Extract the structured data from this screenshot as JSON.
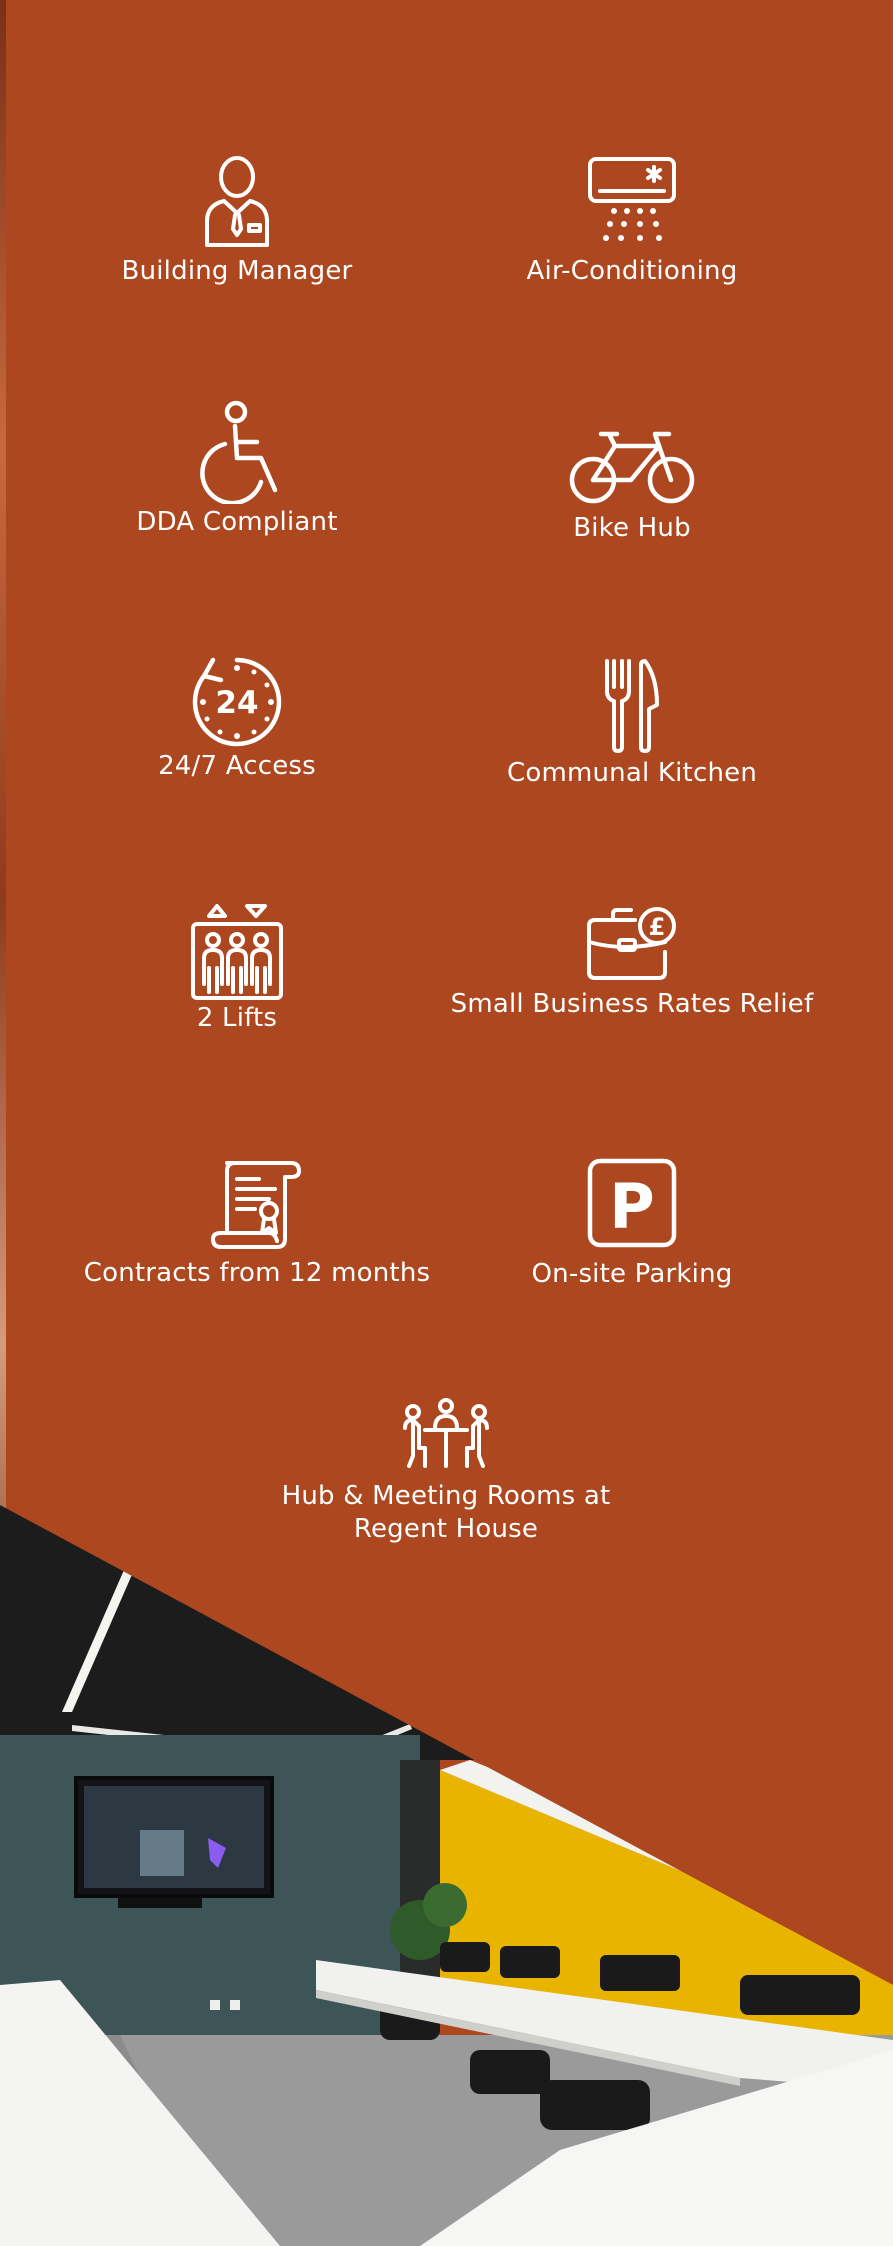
{
  "features": [
    {
      "icon": "building-manager-icon",
      "label": "Building Manager"
    },
    {
      "icon": "air-conditioning-icon",
      "label": "Air-Conditioning"
    },
    {
      "icon": "wheelchair-icon",
      "label": "DDA Compliant"
    },
    {
      "icon": "bicycle-icon",
      "label": "Bike Hub"
    },
    {
      "icon": "clock-24-icon",
      "label": "24/7 Access"
    },
    {
      "icon": "fork-knife-icon",
      "label": "Communal Kitchen"
    },
    {
      "icon": "lift-icon",
      "label": "2 Lifts"
    },
    {
      "icon": "briefcase-pound-icon",
      "label": "Small Business Rates Relief"
    },
    {
      "icon": "contract-icon",
      "label": "Contracts from 12 months"
    },
    {
      "icon": "parking-icon",
      "label": "On-site Parking"
    },
    {
      "icon": "meeting-room-icon",
      "label": "Hub & Meeting Rooms at Regent House"
    }
  ],
  "icon_text": {
    "clock": "24",
    "parking": "P",
    "pound": "£"
  },
  "colors": {
    "background": "#ad4720",
    "foreground": "#ffffff",
    "accent_yellow": "#e8b400",
    "wall_teal": "#3d5557"
  }
}
